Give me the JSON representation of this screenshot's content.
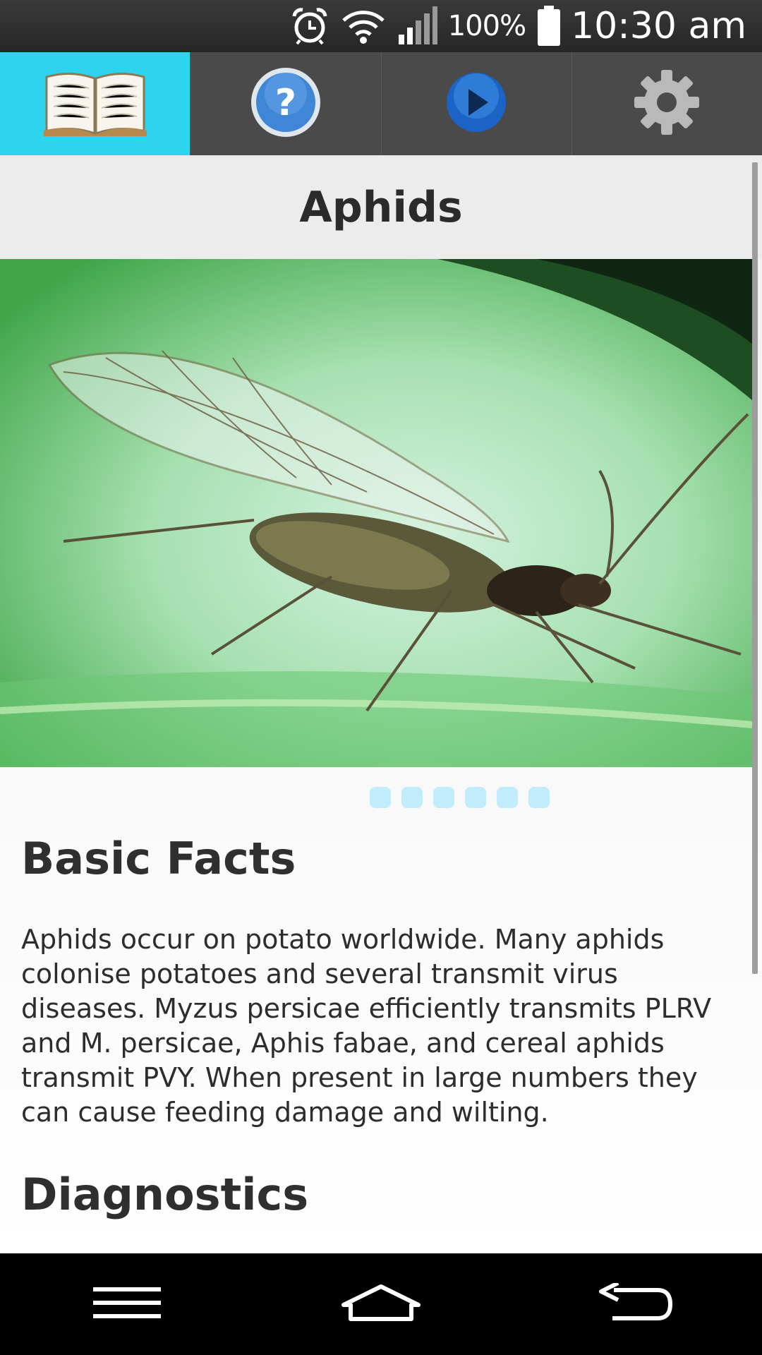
{
  "status_bar": {
    "battery_percent": "100%",
    "time": "10:30 am",
    "icons": [
      "alarm-clock-icon",
      "wifi-icon",
      "signal-icon",
      "battery-icon"
    ]
  },
  "tabs": [
    {
      "icon": "book-icon",
      "active": true
    },
    {
      "icon": "help-icon",
      "active": false
    },
    {
      "icon": "play-icon",
      "active": false
    },
    {
      "icon": "gear-icon",
      "active": false
    }
  ],
  "page": {
    "title": "Aphids",
    "image": {
      "subject": "aphid-on-leaf-photo",
      "page_count": 6
    },
    "sections": [
      {
        "heading": "Basic Facts",
        "body": "Aphids occur on potato worldwide.  Many aphids colonise potatoes and several transmit virus diseases.  Myzus persicae efficiently transmits PLRV and M. persicae, Aphis fabae, and cereal aphids transmit PVY.  When present in large numbers they can cause feeding damage and wilting."
      },
      {
        "heading": "Diagnostics"
      }
    ]
  },
  "nav_bar": {
    "icons": [
      "menu-icon",
      "home-icon",
      "back-icon"
    ]
  },
  "colors": {
    "active_tab": "#2ed3ee",
    "tab_bar": "#4a4a4a",
    "pager_dot": "#c0ecfb"
  }
}
